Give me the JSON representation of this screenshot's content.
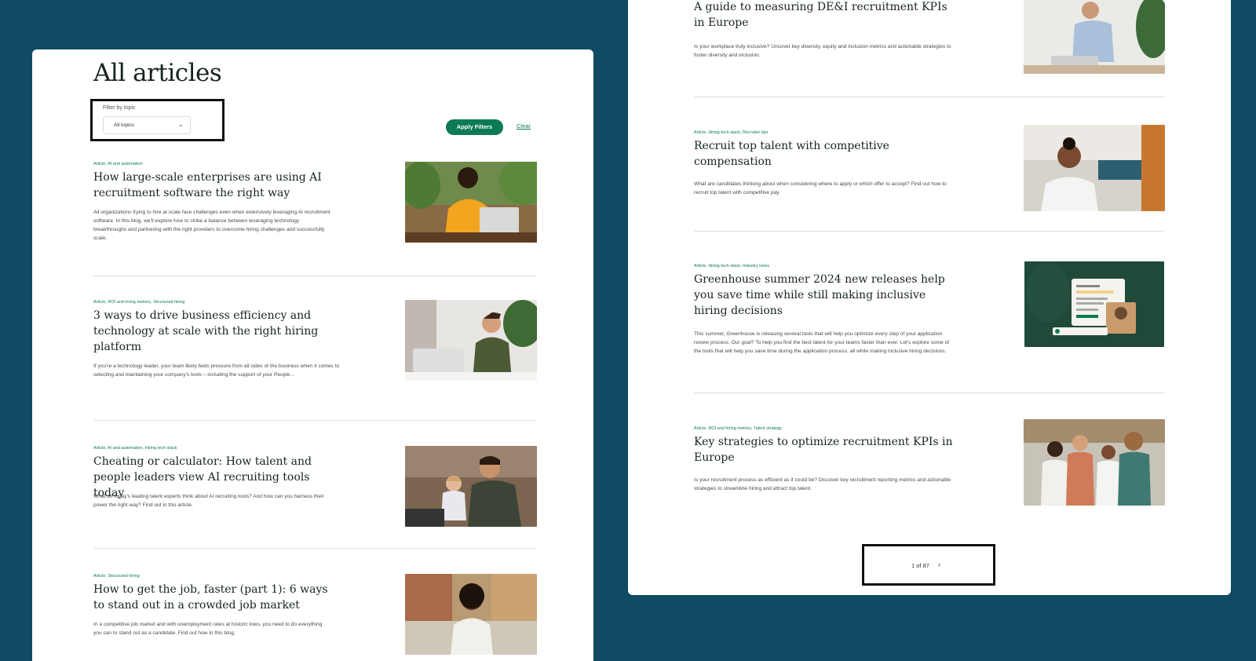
{
  "left_page": {
    "title": "All articles",
    "filter": {
      "label": "Filter by topic",
      "value": "All topics"
    },
    "apply_label": "Apply Filters",
    "clear_label": "Clear",
    "articles": [
      {
        "tags": "Article, AI and automation",
        "title": "How large-scale enterprises are using AI recruitment software the right way",
        "description": "All organizations trying to hire at scale face challenges even when extensively leveraging AI recruitment software. In this blog, we'll explore how to strike a balance between leveraging technology breakthroughs and partnering with the right providers to overcome hiring challenges and successfully scale."
      },
      {
        "tags": "Article, ROI and hiring metrics, Structured hiring",
        "title": "3 ways to drive business efficiency and technology at scale with the right hiring platform",
        "description": "If you're a technology leader, your team likely feels pressure from all sides of the business when it comes to selecting and maintaining your company's tools – including the support of your People..."
      },
      {
        "tags": "Article, AI and automation, Hiring tech stack",
        "title": "Cheating or calculator: How talent and people leaders view AI recruiting tools today",
        "description": "What do today's leading talent experts think about AI recruiting tools? And how can you harness their power the right way? Find out in this article."
      },
      {
        "tags": "Article, Structured hiring",
        "title": "How to get the job, faster (part 1): 6 ways to stand out in a crowded job market",
        "description": "In a competitive job market and with unemployment rates at historic lows, you need to do everything you can to stand out as a candidate. Find out how in this blog."
      }
    ]
  },
  "right_page": {
    "articles": [
      {
        "tags": "",
        "title": "A guide to measuring DE&I recruitment KPIs in Europe",
        "description": "Is your workplace truly inclusive? Uncover key diversity, equity and inclusion metrics and actionable strategies to foster diversity and inclusion."
      },
      {
        "tags": "Article, Hiring tech stack, Recruiter tips",
        "title": "Recruit top talent with competitive compensation",
        "description": "What are candidates thinking about when considering where to apply or which offer to accept? Find out how to recruit top talent with competitive pay."
      },
      {
        "tags": "Article, Hiring tech stack, Industry news",
        "title": "Greenhouse summer 2024 new releases help you save time while still making inclusive hiring decisions",
        "description": "This summer, Greenhouse is releasing several tools that will help you optimize every step of your application review process. Our goal? To help you find the best talent for your teams faster than ever. Let's explore some of the tools that will help you save time during the application process, all while making inclusive hiring decisions."
      },
      {
        "tags": "Article, ROI and hiring metrics, Talent strategy",
        "title": "Key strategies to optimize recruitment KPIs in Europe",
        "description": "Is your recruitment process as efficient as it could be? Discover key recruitment reporting metrics and actionable strategies to streamline hiring and attract top talent."
      }
    ],
    "pagination": {
      "text": "1 of 87"
    }
  },
  "colors": {
    "background": "#104a63",
    "accent": "#0c7a55",
    "divider": "#d5e2db",
    "heading": "#15241d"
  },
  "icons": {
    "filter_chevron": "chevron-down-icon",
    "pagination_next": "chevron-right-icon"
  }
}
